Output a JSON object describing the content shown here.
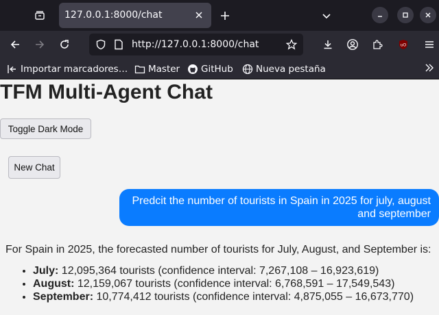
{
  "browser": {
    "tab_title": "127.0.0.1:8000/chat",
    "url": "http://127.0.0.1:8000/chat",
    "bookmarks": [
      {
        "label": "Importar marcadores…"
      },
      {
        "label": "Master"
      },
      {
        "label": "GitHub"
      },
      {
        "label": "Nueva pestaña"
      }
    ]
  },
  "page": {
    "title": "TFM Multi-Agent Chat",
    "toggle_dark_label": "Toggle Dark Mode",
    "new_chat_label": "New Chat"
  },
  "chat": {
    "user_message": "Predcit the number of tourists in Spain in 2025 for july, august and september",
    "assistant_intro": "For Spain in 2025, the forecasted number of tourists for July, August, and September is:",
    "forecasts": [
      {
        "month": "July:",
        "text": " 12,095,364 tourists (confidence interval: 7,267,108 – 16,923,619)"
      },
      {
        "month": "August:",
        "text": " 12,159,067 tourists (confidence interval: 6,768,591 – 17,549,543)"
      },
      {
        "month": "September:",
        "text": " 10,774,412 tourists (confidence interval: 4,875,055 – 16,673,770)"
      }
    ]
  },
  "colors": {
    "user_bubble": "#0a7cff",
    "tabbar": "#1c1b22",
    "toolbar": "#2b2a33"
  }
}
